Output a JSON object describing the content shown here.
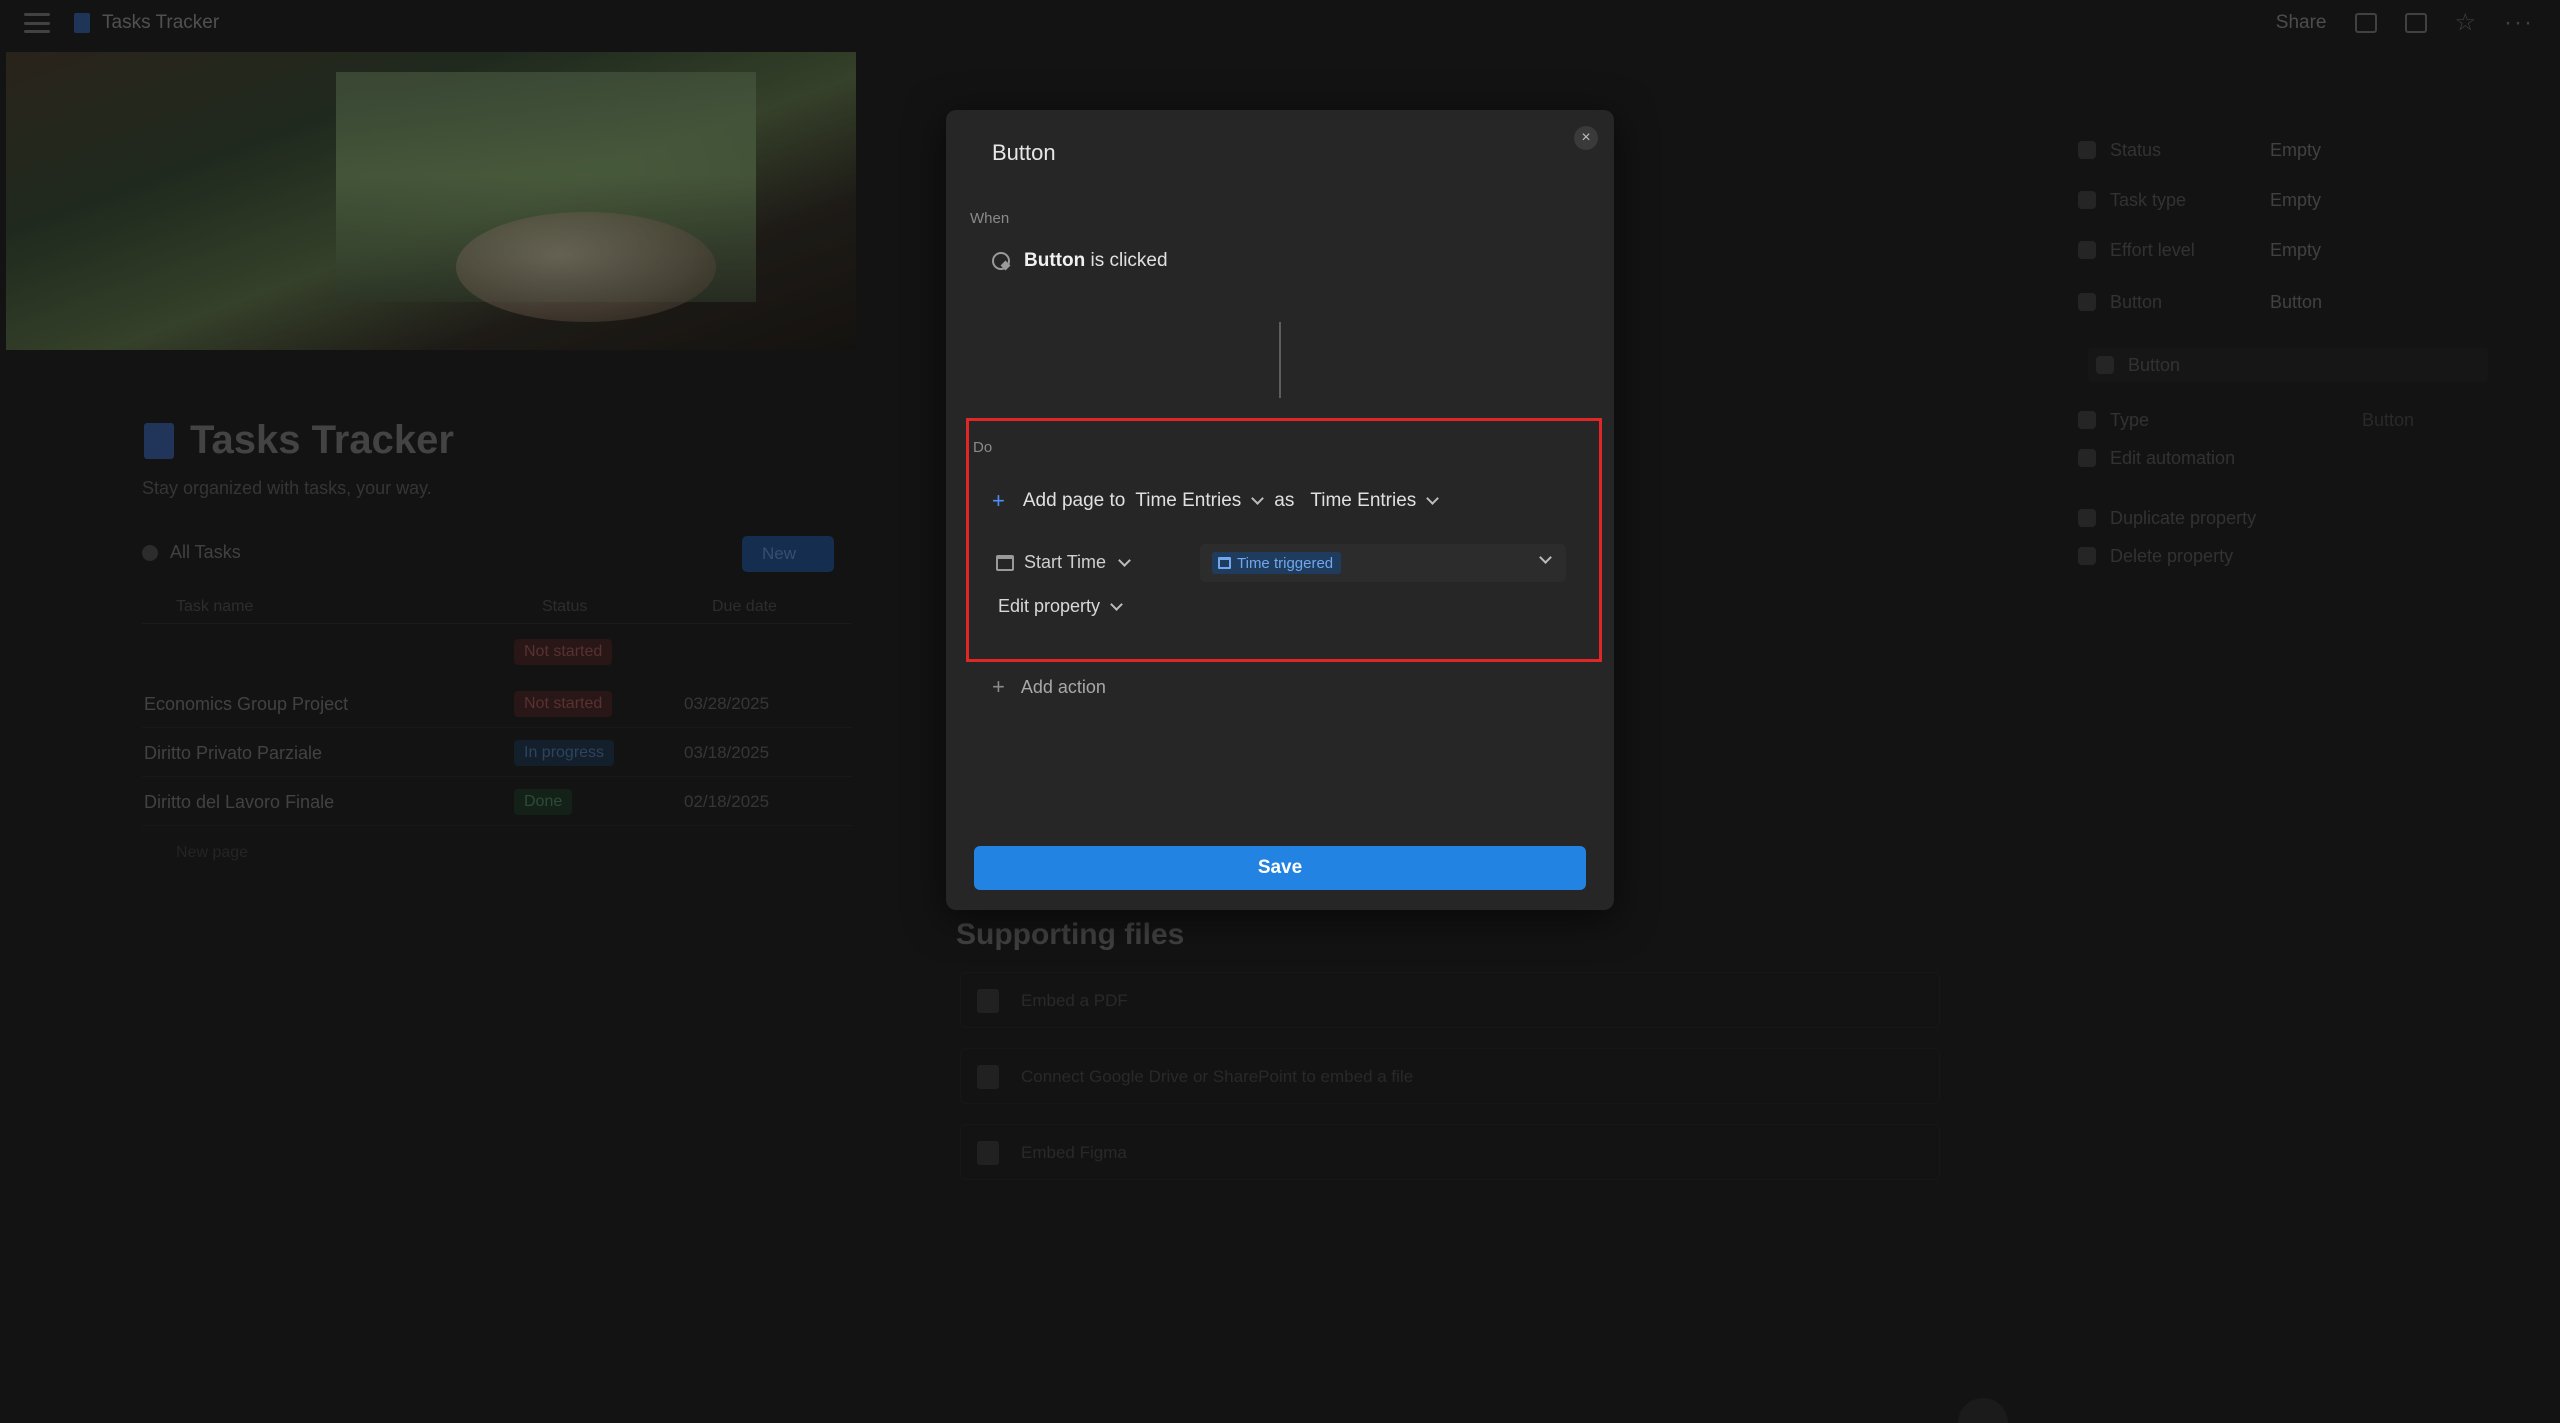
{
  "app": {
    "title": "Tasks Tracker",
    "share_label": "Share"
  },
  "page": {
    "title": "Tasks Tracker",
    "subtitle": "Stay organized with tasks, your way.",
    "view_label": "All Tasks",
    "new_label": "New",
    "columns": [
      "Task name",
      "Status",
      "Due date"
    ],
    "header_status": "Not started",
    "rows": [
      {
        "name": "Economics Group Project",
        "status": "Not started",
        "date": "03/28/2025"
      },
      {
        "name": "Diritto Privato Parziale",
        "status": "In progress",
        "date": "03/18/2025"
      },
      {
        "name": "Diritto del Lavoro Finale",
        "status": "Done",
        "date": "02/18/2025"
      }
    ],
    "new_page_label": "New page"
  },
  "supporting": {
    "title": "Supporting files",
    "items": [
      "Embed a PDF",
      "Connect Google Drive or SharePoint to embed a file",
      "Embed Figma"
    ]
  },
  "properties_panel": {
    "items": [
      {
        "label": "Status",
        "value": "Empty"
      },
      {
        "label": "Task type",
        "value": "Empty"
      },
      {
        "label": "Effort level",
        "value": "Empty"
      },
      {
        "label": "Button",
        "value": "Button"
      },
      {
        "label": "Button",
        "value": ""
      },
      {
        "label": "Type",
        "value": "Button"
      },
      {
        "label": "Edit automation",
        "value": ""
      },
      {
        "label": "Duplicate property",
        "value": ""
      },
      {
        "label": "Delete property",
        "value": ""
      }
    ]
  },
  "modal": {
    "title": "Button",
    "close_glyph": "×",
    "when_label": "When",
    "trigger_bold": "Button",
    "trigger_rest": " is clicked",
    "do_label": "Do",
    "action": {
      "prefix": "Add page to",
      "database": "Time Entries",
      "mid": "as",
      "template": "Time Entries"
    },
    "property": {
      "name": "Start Time",
      "value": "Time triggered"
    },
    "edit_property_label": "Edit property",
    "add_action_label": "Add action",
    "save_label": "Save"
  },
  "colors": {
    "accent": "#2383e2",
    "highlight_border": "#e02727"
  }
}
